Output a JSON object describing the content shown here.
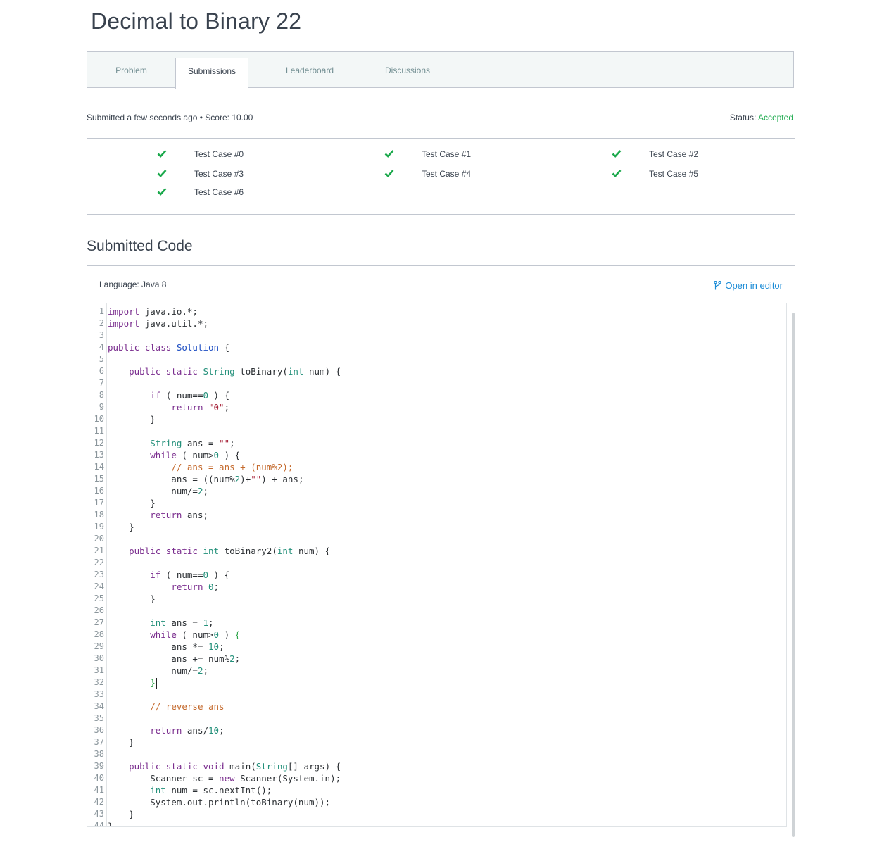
{
  "page": {
    "title": "Decimal to Binary 22"
  },
  "tabs": [
    "Problem",
    "Submissions",
    "Leaderboard",
    "Discussions"
  ],
  "active_tab": "Submissions",
  "submission": {
    "summary": "Submitted a few seconds ago • Score: 10.00",
    "status_label": "Status:",
    "status_value": "Accepted"
  },
  "test_cases": [
    "Test Case #0",
    "Test Case #1",
    "Test Case #2",
    "Test Case #3",
    "Test Case #4",
    "Test Case #5",
    "Test Case #6"
  ],
  "submitted_code": {
    "heading": "Submitted Code",
    "language": "Language: Java 8",
    "open_in_editor": "Open in editor"
  },
  "colors": {
    "accent": "#1ba94c",
    "link": "#1a8bd6"
  },
  "code_lines": [
    "import java.io.*;",
    "import java.util.*;",
    "",
    "public class Solution {",
    "",
    "    public static String toBinary(int num) {",
    "",
    "        if ( num==0 ) {",
    "            return \"0\";",
    "        }",
    "",
    "        String ans = \"\";",
    "        while ( num>0 ) {",
    "            // ans = ans + (num%2);",
    "            ans = ((num%2)+\"\") + ans;",
    "            num/=2;",
    "        }",
    "        return ans;",
    "    }",
    "",
    "    public static int toBinary2(int num) {",
    "",
    "        if ( num==0 ) {",
    "            return 0;",
    "        }",
    "",
    "        int ans = 1;",
    "        while ( num>0 ) {",
    "            ans *= 10;",
    "            ans += num%2;",
    "            num/=2;",
    "        }",
    "",
    "        // reverse ans",
    "",
    "        return ans/10;",
    "    }",
    "",
    "    public static void main(String[] args) {",
    "        Scanner sc = new Scanner(System.in);",
    "        int num = sc.nextInt();",
    "        System.out.println(toBinary(num));",
    "    }",
    "}"
  ]
}
